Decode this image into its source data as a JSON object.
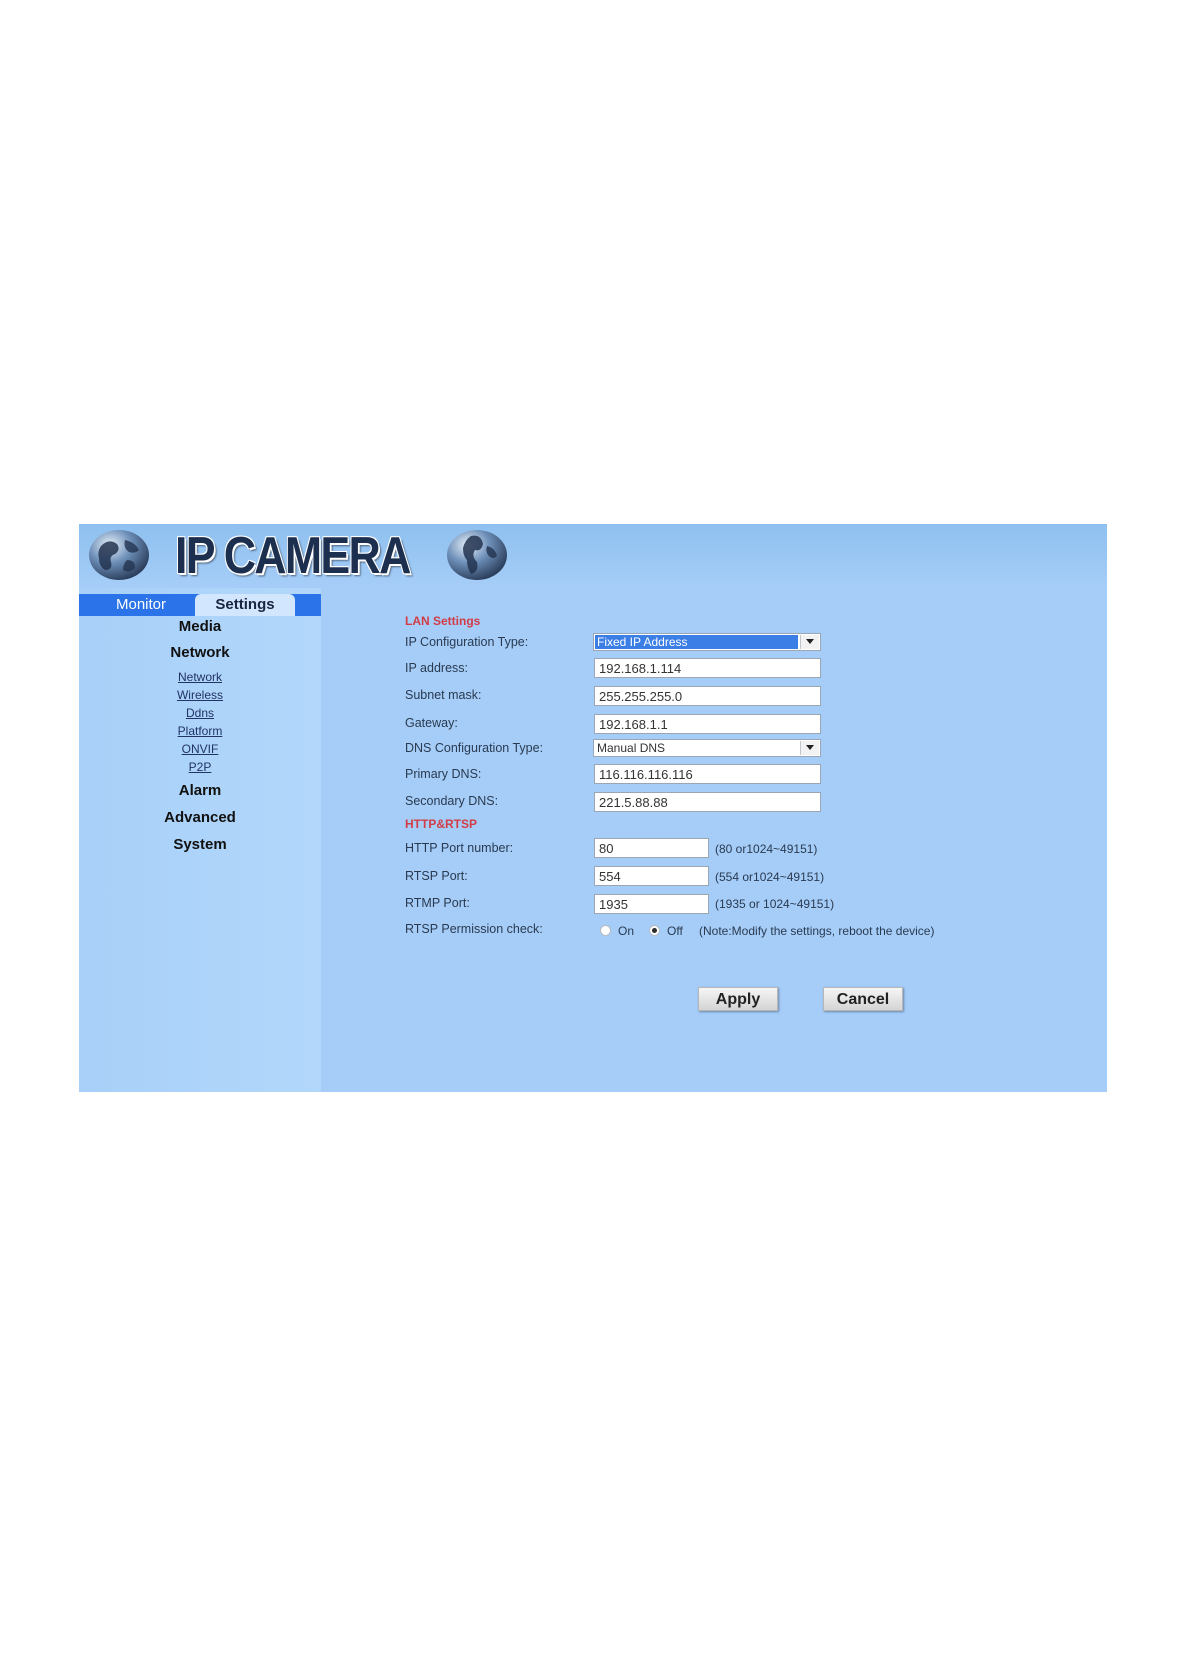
{
  "header": {
    "logo_text": "IP CAMERA"
  },
  "tabs": [
    {
      "label": "Monitor"
    },
    {
      "label": "Settings",
      "active": true
    }
  ],
  "sidebar": {
    "menu": [
      "Media",
      "Network",
      "Alarm",
      "Advanced",
      "System"
    ],
    "network_links": [
      "Network",
      "Wireless",
      "Ddns",
      "Platform",
      "ONVIF",
      "P2P"
    ]
  },
  "lan": {
    "section_title": "LAN Settings",
    "ip_config_type_label": "IP Configuration Type:",
    "ip_config_type_value": "Fixed IP Address",
    "ip_address_label": "IP address:",
    "ip_address_value": "192.168.1.114",
    "subnet_mask_label": "Subnet mask:",
    "subnet_mask_value": "255.255.255.0",
    "gateway_label": "Gateway:",
    "gateway_value": "192.168.1.1",
    "dns_config_type_label": "DNS Configuration Type:",
    "dns_config_type_value": "Manual DNS",
    "primary_dns_label": "Primary DNS:",
    "primary_dns_value": "116.116.116.116",
    "secondary_dns_label": "Secondary DNS:",
    "secondary_dns_value": "221.5.88.88"
  },
  "http_rtsp": {
    "section_title": "HTTP&RTSP",
    "http_port_label": "HTTP Port number:",
    "http_port_value": "80",
    "http_port_hint": "(80 or1024~49151)",
    "rtsp_port_label": "RTSP Port:",
    "rtsp_port_value": "554",
    "rtsp_port_hint": "(554 or1024~49151)",
    "rtmp_port_label": "RTMP Port:",
    "rtmp_port_value": "1935",
    "rtmp_port_hint": "(1935 or 1024~49151)",
    "permission_label": "RTSP Permission check:",
    "permission_on_label": "On",
    "permission_off_label": "Off",
    "permission_selected": "Off",
    "permission_note": "(Note:Modify the settings, reboot the device)"
  },
  "buttons": {
    "apply": "Apply",
    "cancel": "Cancel"
  },
  "colors": {
    "panel_bg": "#a6cdf7",
    "tab_strip": "#2a73e8",
    "section_title": "#d23c46",
    "selected_option": "#3a7ee6"
  },
  "icons": [
    "globe-icon",
    "dropdown-arrow-icon"
  ]
}
